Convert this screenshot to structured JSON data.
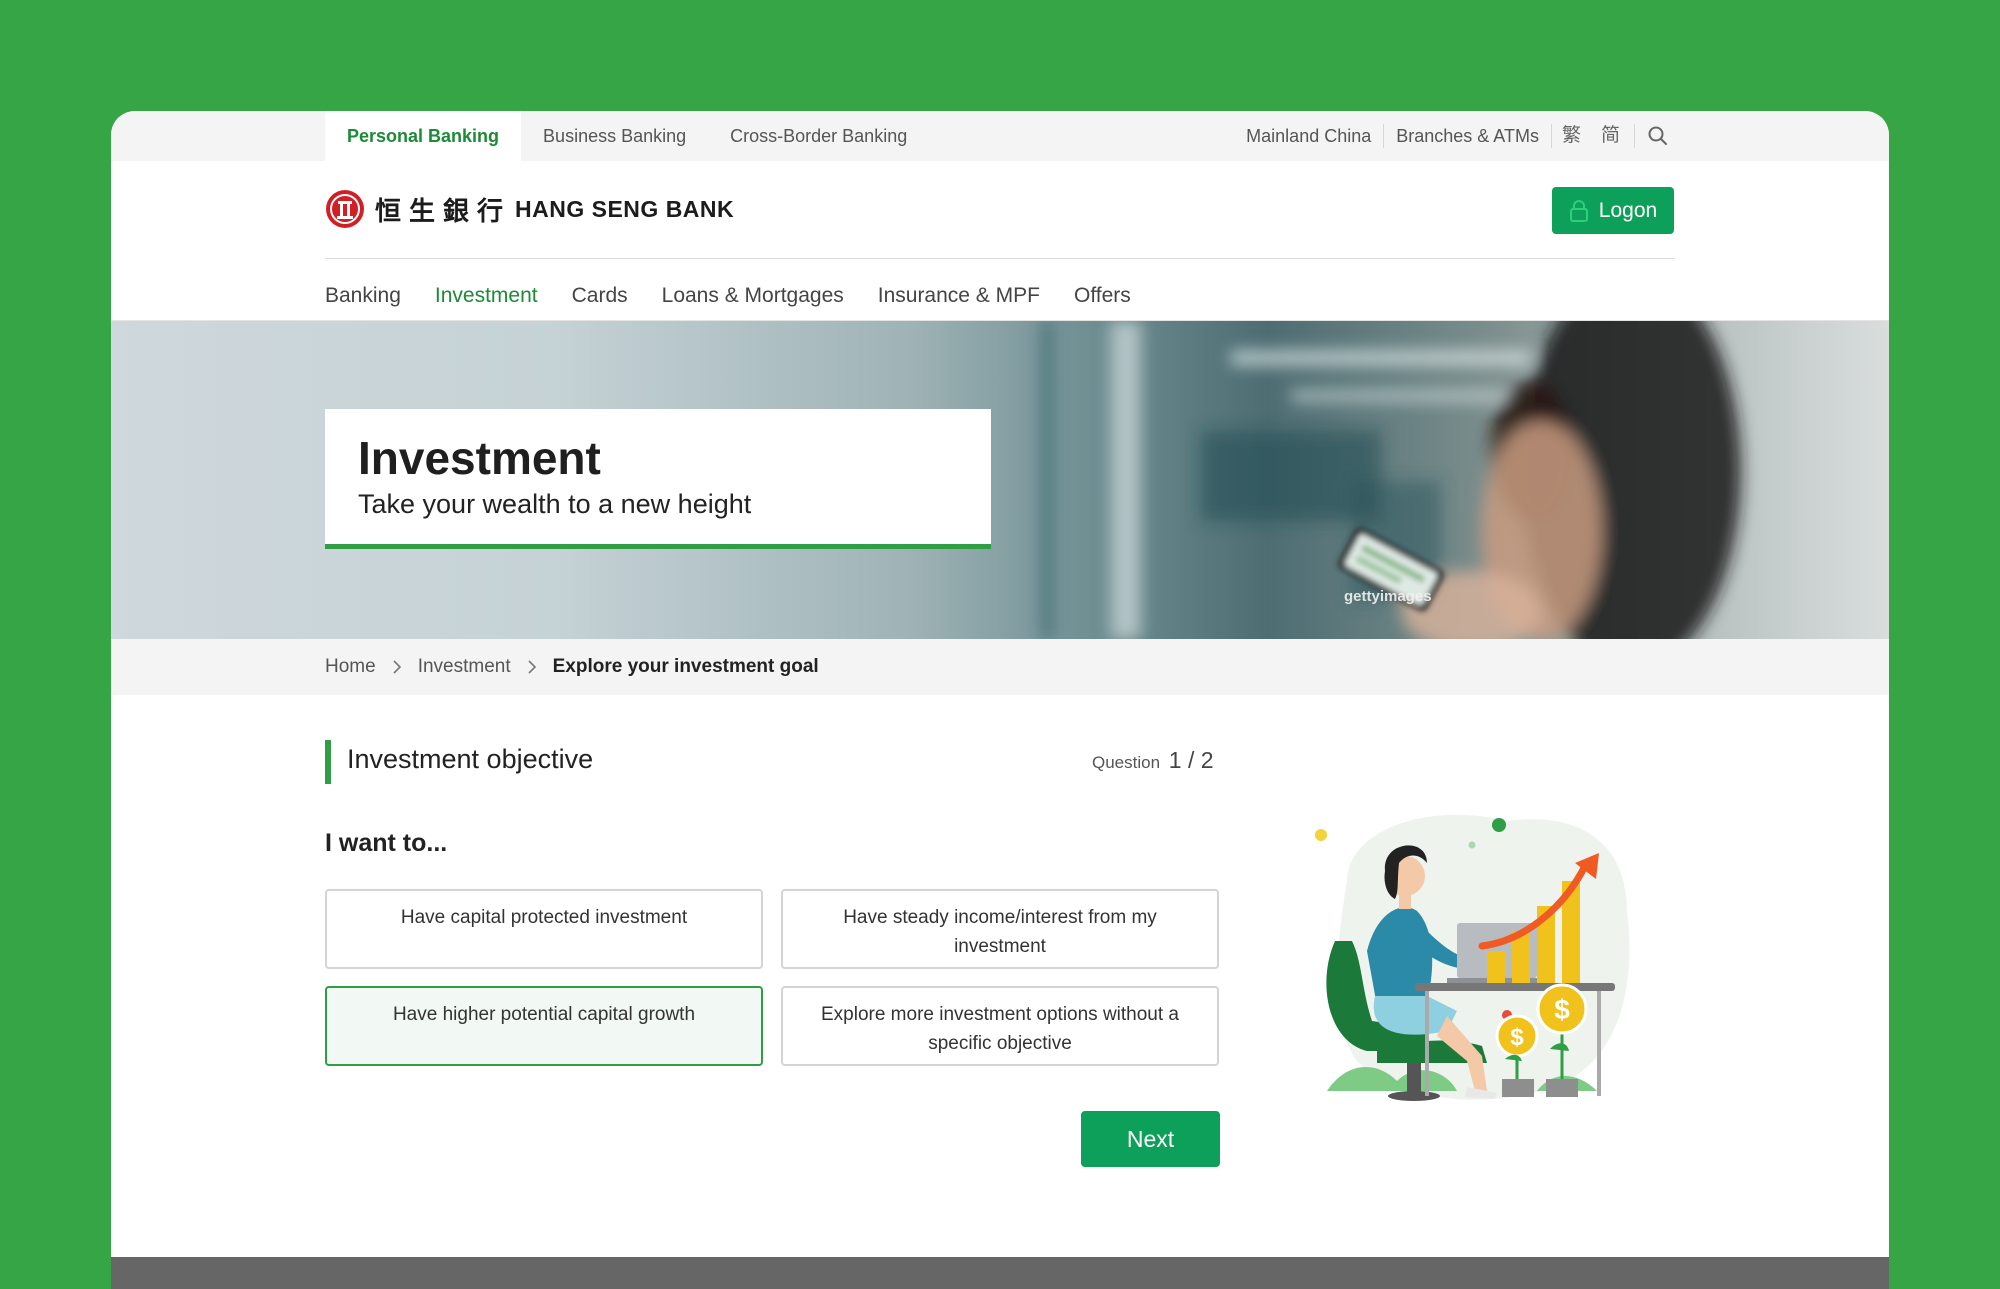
{
  "segments": [
    {
      "label": "Personal Banking",
      "active": true
    },
    {
      "label": "Business Banking",
      "active": false
    },
    {
      "label": "Cross-Border Banking",
      "active": false
    }
  ],
  "utility": {
    "mainland": "Mainland China",
    "branches": "Branches & ATMs",
    "trad": "繁",
    "simp": "简",
    "search_icon": "search-icon"
  },
  "brand": {
    "cjk": "恒生銀行",
    "name": "HANG SENG BANK",
    "color": "#d21f26"
  },
  "logon": {
    "label": "Logon",
    "icon": "lock-icon"
  },
  "nav": [
    {
      "label": "Banking",
      "active": false
    },
    {
      "label": "Investment",
      "active": true
    },
    {
      "label": "Cards",
      "active": false
    },
    {
      "label": "Loans & Mortgages",
      "active": false
    },
    {
      "label": "Insurance & MPF",
      "active": false
    },
    {
      "label": "Offers",
      "active": false
    }
  ],
  "hero": {
    "title": "Investment",
    "subtitle": "Take your wealth to a new height",
    "credit": "gettyimages"
  },
  "breadcrumb": [
    "Home",
    "Investment",
    "Explore your investment goal"
  ],
  "question": {
    "section_title": "Investment objective",
    "counter_label": "Question",
    "counter_value": "1 / 2",
    "prompt": "I want to...",
    "options": [
      {
        "label": "Have capital protected investment",
        "selected": false
      },
      {
        "label": "Have steady income/interest from my investment",
        "selected": false
      },
      {
        "label": "Have higher potential capital growth",
        "selected": true
      },
      {
        "label": "Explore more investment options without a specific objective",
        "selected": false
      }
    ],
    "next_label": "Next"
  },
  "colors": {
    "accent": "#2f9e44",
    "button": "#0da05a",
    "background": "#35a546"
  }
}
